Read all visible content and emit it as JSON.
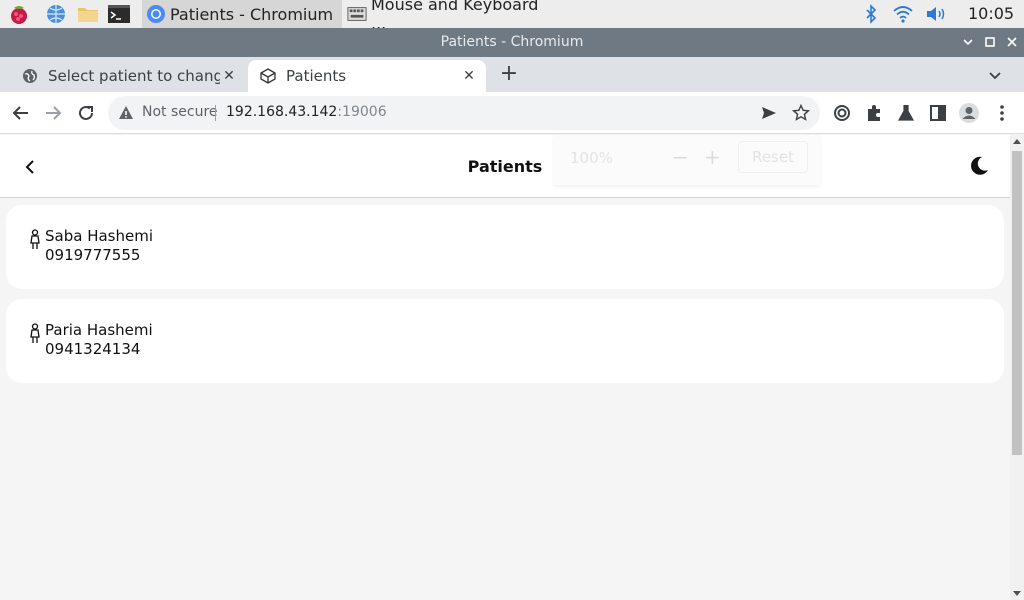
{
  "taskbar": {
    "tasks": [
      {
        "label": "Patients - Chromium",
        "icon": "chromium-icon"
      },
      {
        "label": "Mouse and Keyboard ...",
        "icon": "keyboard-icon"
      }
    ],
    "clock": "10:05",
    "tray": [
      "bluetooth-icon",
      "wifi-icon",
      "volume-icon"
    ]
  },
  "window": {
    "title": "Patients - Chromium"
  },
  "tabs": [
    {
      "label": "Select patient to change",
      "icon": "globe-icon",
      "active": false
    },
    {
      "label": "Patients",
      "icon": "cube-icon",
      "active": true
    }
  ],
  "toolbar": {
    "security_label": "Not secure",
    "url_host": "192.168.43.142",
    "url_port": ":19006"
  },
  "zoom_popup": {
    "value": "100%",
    "minus": "−",
    "plus": "+",
    "reset": "Reset"
  },
  "page": {
    "title": "Patients",
    "patients": [
      {
        "name": "Saba Hashemi",
        "phone": "0919777555"
      },
      {
        "name": "Paria Hashemi",
        "phone": "0941324134"
      }
    ]
  }
}
